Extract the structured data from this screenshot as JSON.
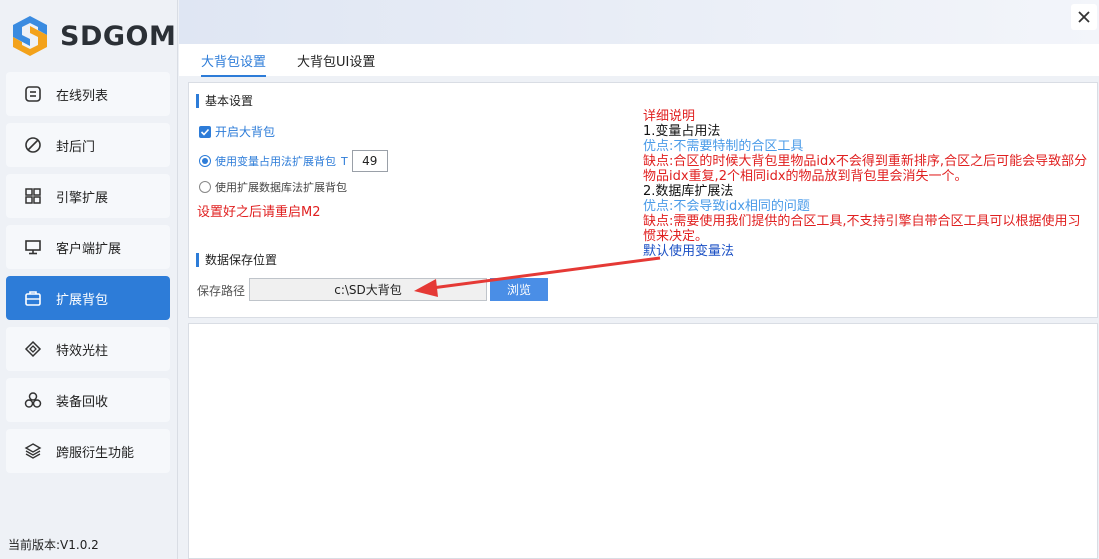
{
  "brand": {
    "name": "SDGOM"
  },
  "sidebar": {
    "items": [
      {
        "label": "在线列表",
        "icon": "list-box-icon"
      },
      {
        "label": "封后门",
        "icon": "block-icon"
      },
      {
        "label": "引擎扩展",
        "icon": "grid-icon"
      },
      {
        "label": "客户端扩展",
        "icon": "monitor-icon"
      },
      {
        "label": "扩展背包",
        "icon": "bag-icon",
        "active": true
      },
      {
        "label": "特效光柱",
        "icon": "diamond-icon"
      },
      {
        "label": "装备回收",
        "icon": "recycle-icon"
      },
      {
        "label": "跨服衍生功能",
        "icon": "layers-icon"
      }
    ],
    "version": "当前版本:V1.0.2"
  },
  "tabs": [
    {
      "label": "大背包设置",
      "active": true
    },
    {
      "label": "大背包UI设置",
      "active": false
    }
  ],
  "settings": {
    "basic_title": "基本设置",
    "enable_label": "开启大背包",
    "enable_checked": true,
    "option1_label": "使用变量占用法扩展背包",
    "option1_suffix": "T",
    "option1_value": "49",
    "option2_label": "使用扩展数据库法扩展背包",
    "warning": "设置好之后请重启M2",
    "storage_title": "数据保存位置",
    "path_label": "保存路径",
    "path_value": "c:\\SD大背包",
    "browse_label": "浏览"
  },
  "description": {
    "title": "详细说明",
    "m1_title": "1.变量占用法",
    "m1_pro": "优点:不需要特制的合区工具",
    "m1_con": "缺点:合区的时候大背包里物品idx不会得到重新排序,合区之后可能会导致部分物品idx重复,2个相同idx的物品放到背包里会消失一个。",
    "m2_title": "2.数据库扩展法",
    "m2_pro": "优点:不会导致idx相同的问题",
    "m2_con": "缺点:需要使用我们提供的合区工具,不支持引擎自带合区工具可以根据使用习惯来决定。",
    "default": "默认使用变量法"
  },
  "colors": {
    "accent": "#2d7cd8",
    "warning": "#e02020",
    "pro": "#4a9be8",
    "default_note": "#1a4fc4"
  }
}
